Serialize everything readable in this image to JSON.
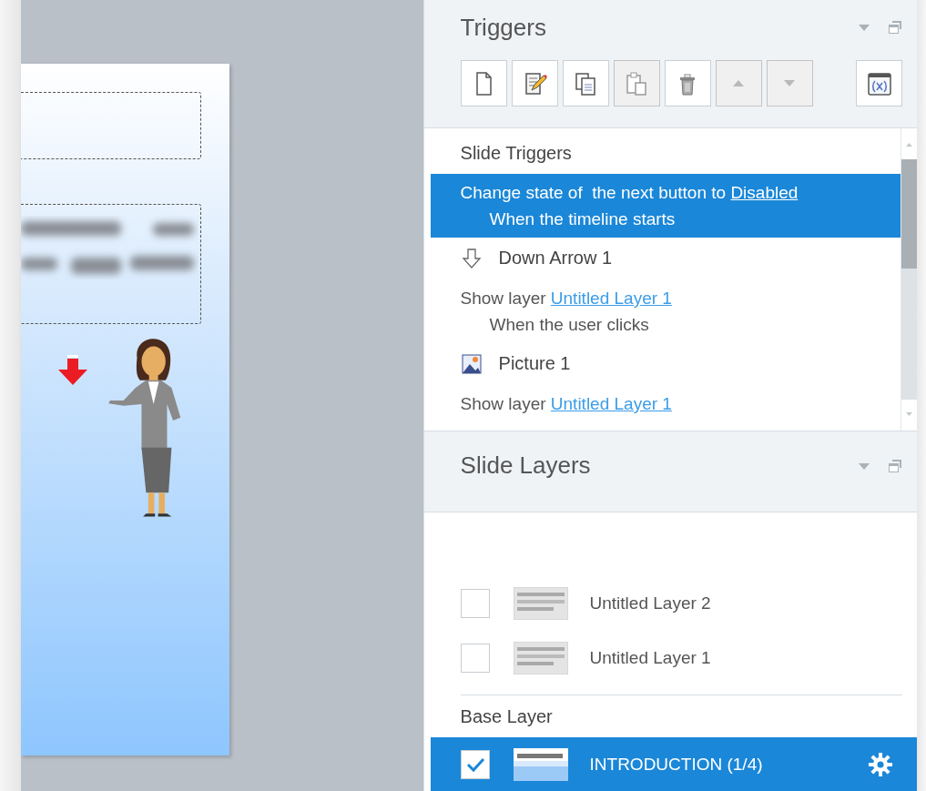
{
  "triggers_panel": {
    "title": "Triggers",
    "toolbar": [
      {
        "kind": "new",
        "disabled": false
      },
      {
        "kind": "edit",
        "disabled": false
      },
      {
        "kind": "copy",
        "disabled": false
      },
      {
        "kind": "paste",
        "disabled": true
      },
      {
        "kind": "delete",
        "disabled": false
      },
      {
        "kind": "up",
        "disabled": true
      },
      {
        "kind": "down",
        "disabled": true
      },
      {
        "kind": "variables",
        "disabled": false
      }
    ],
    "items": [
      {
        "kind": "heading",
        "label": "Slide Triggers"
      },
      {
        "kind": "trigger",
        "action": "Change state of  the next button to",
        "link": "Disabled",
        "condition": "When the timeline starts",
        "selected": true
      },
      {
        "kind": "arrow",
        "label": "Down Arrow 1"
      },
      {
        "kind": "trigger",
        "action": "Show layer",
        "link": "Untitled Layer 1",
        "condition": "When the user clicks",
        "selected": false
      },
      {
        "kind": "picture",
        "label": "Picture 1"
      },
      {
        "kind": "trigger",
        "action": "Show layer",
        "link": "Untitled Layer 1",
        "selected": false
      }
    ]
  },
  "layers_panel": {
    "title": "Slide Layers",
    "layers": [
      {
        "name": "Untitled Layer 2",
        "checked": false,
        "selected": false
      },
      {
        "name": "Untitled Layer 1",
        "checked": false,
        "selected": false
      }
    ],
    "base_heading": "Base Layer",
    "base_layer": {
      "name": "INTRODUCTION (1/4)",
      "checked": true,
      "selected": true
    }
  }
}
